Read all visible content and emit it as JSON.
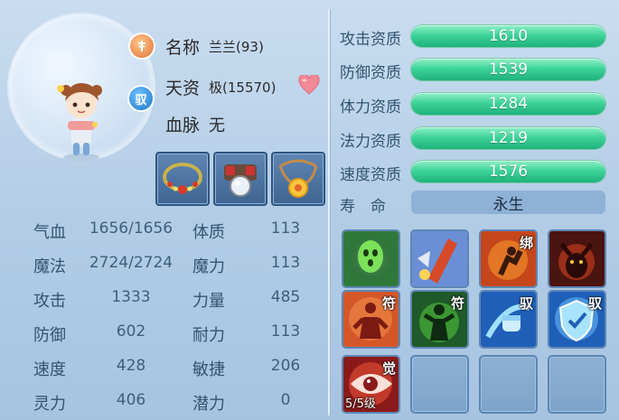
{
  "pet": {
    "name_label": "名称",
    "name_value": "兰兰(93)",
    "talent_label": "天资",
    "talent_value": "极(15570)",
    "bloodline_label": "血脉",
    "bloodline_value": "无",
    "tame_badge": "驭"
  },
  "stats": [
    {
      "label": "气血",
      "value": "1656/1656",
      "label2": "体质",
      "value2": "113"
    },
    {
      "label": "魔法",
      "value": "2724/2724",
      "label2": "魔力",
      "value2": "113"
    },
    {
      "label": "攻击",
      "value": "1333",
      "label2": "力量",
      "value2": "485"
    },
    {
      "label": "防御",
      "value": "602",
      "label2": "耐力",
      "value2": "113"
    },
    {
      "label": "速度",
      "value": "428",
      "label2": "敏捷",
      "value2": "206"
    },
    {
      "label": "灵力",
      "value": "406",
      "label2": "潜力",
      "value2": "0"
    }
  ],
  "aptitudes": [
    {
      "label": "攻击资质",
      "value": "1610"
    },
    {
      "label": "防御资质",
      "value": "1539"
    },
    {
      "label": "体力资质",
      "value": "1284"
    },
    {
      "label": "法力资质",
      "value": "1219"
    },
    {
      "label": "速度资质",
      "value": "1576"
    }
  ],
  "lifespan": {
    "label": "寿　命",
    "value": "永生"
  },
  "skills": [
    {
      "icon": "green-spirit-icon",
      "tag": ""
    },
    {
      "icon": "red-blade-strike-icon",
      "tag": ""
    },
    {
      "icon": "fire-runner-bind-icon",
      "tag": "绑"
    },
    {
      "icon": "horned-demon-icon",
      "tag": ""
    },
    {
      "icon": "red-figure-talisman-icon",
      "tag": "符"
    },
    {
      "icon": "green-warrior-talisman-icon",
      "tag": "符"
    },
    {
      "icon": "blue-fist-tame-icon",
      "tag": "驭"
    },
    {
      "icon": "blue-shield-tame-icon",
      "tag": "驭"
    },
    {
      "icon": "awaken-eye-icon",
      "tag": "觉",
      "level": "5/5级"
    }
  ],
  "colors": {
    "accent_green": "#3ed39a",
    "panel_bg": "#b3cde6"
  }
}
